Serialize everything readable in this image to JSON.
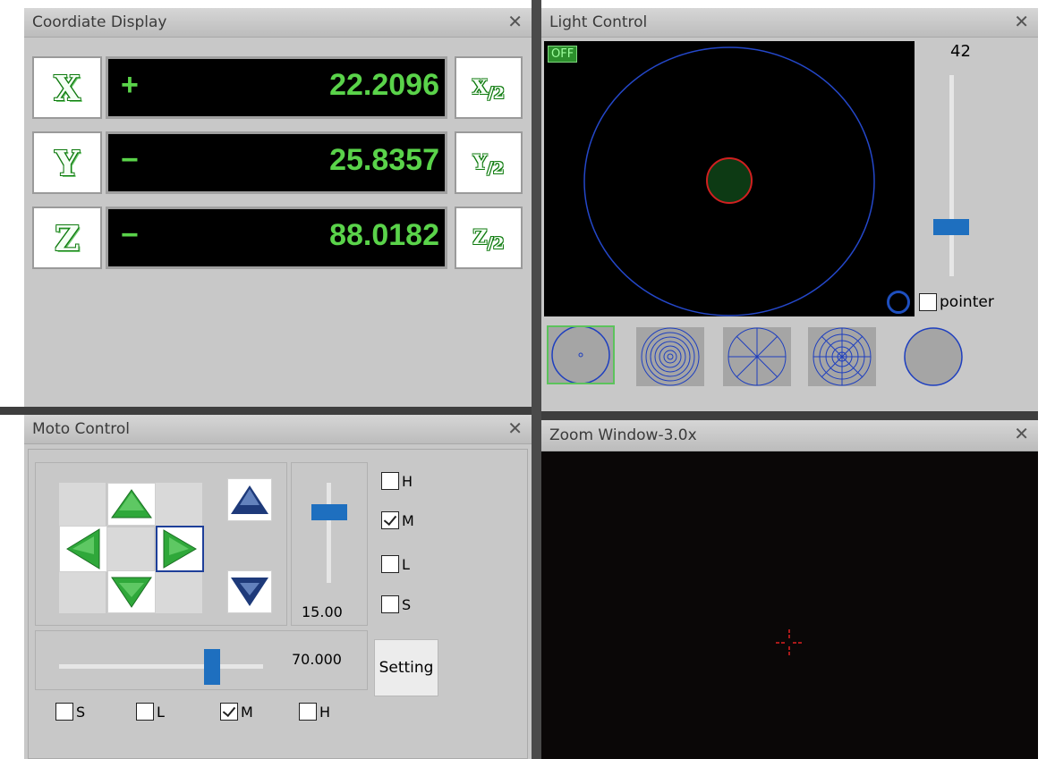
{
  "coord": {
    "title": "Coordiate Display",
    "close": "✕",
    "rows": [
      {
        "axis": "X",
        "sign": "+",
        "value": "22.2096",
        "half_main": "X",
        "half_sub": "/2"
      },
      {
        "axis": "Y",
        "sign": "−",
        "value": "25.8357",
        "half_main": "Y",
        "half_sub": "/2"
      },
      {
        "axis": "Z",
        "sign": "−",
        "value": "88.0182",
        "half_main": "Z",
        "half_sub": "/2"
      }
    ]
  },
  "light": {
    "title": "Light Control",
    "close": "✕",
    "off_label": "OFF",
    "intensity": "42",
    "intensity_fraction": 0.22,
    "pointer_label": "pointer",
    "pointer_checked": false,
    "patterns": [
      "ring-dot-pattern-icon",
      "concentric-rings-pattern-icon",
      "spokes-pattern-icon",
      "segmented-rings-pattern-icon",
      "full-circle-pattern-icon"
    ],
    "selected_pattern": 0,
    "accent": "#1e6fbf",
    "selected_border": "#5cc35c"
  },
  "moto": {
    "title": "Moto Control",
    "close": "✕",
    "step_value": "15.00",
    "step_fraction": 0.75,
    "speed_value": "70.000",
    "speed_fraction": 0.77,
    "setting_label": "Setting",
    "right_checks": [
      {
        "label": "H",
        "checked": false
      },
      {
        "label": "M",
        "checked": true
      },
      {
        "label": "L",
        "checked": false
      },
      {
        "label": "S",
        "checked": false
      }
    ],
    "bottom_checks": [
      {
        "label": "S",
        "checked": false
      },
      {
        "label": "L",
        "checked": false
      },
      {
        "label": "M",
        "checked": true
      },
      {
        "label": "H",
        "checked": false
      }
    ]
  },
  "zoom": {
    "title": "Zoom Window-3.0x",
    "close": "✕",
    "crosshair_color": "#e02020"
  }
}
